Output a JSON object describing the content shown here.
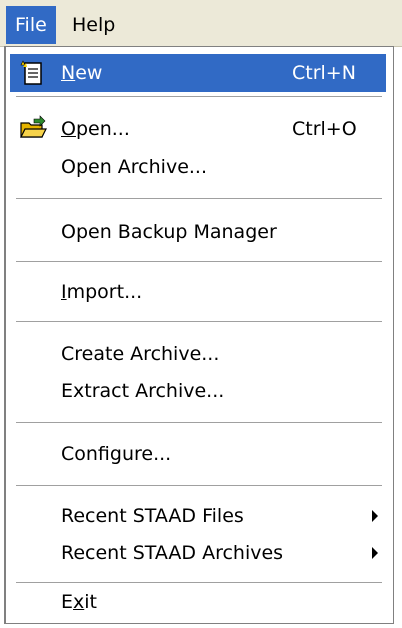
{
  "menubar": {
    "file_label": "File",
    "help_label": "Help"
  },
  "file_menu": {
    "new": {
      "label": "New",
      "accel": "N",
      "shortcut": "Ctrl+N",
      "icon": "new-document-icon"
    },
    "open": {
      "label": "Open...",
      "accel": "O",
      "shortcut": "Ctrl+O",
      "icon": "open-folder-icon"
    },
    "open_archive": {
      "label": "Open Archive..."
    },
    "open_backup_manager": {
      "label": "Open Backup Manager"
    },
    "import": {
      "label": "Import...",
      "accel": "I"
    },
    "create_archive": {
      "label": "Create Archive..."
    },
    "extract_archive": {
      "label": "Extract Archive..."
    },
    "configure": {
      "label": "Configure..."
    },
    "recent_staad_files": {
      "label": "Recent STAAD Files"
    },
    "recent_staad_archives": {
      "label": "Recent STAAD Archives"
    },
    "exit": {
      "label": "Exit",
      "accel": "x"
    }
  },
  "colors": {
    "highlight": "#316ac5",
    "menubar_bg": "#ece9d8",
    "menu_bg": "#ffffff"
  }
}
